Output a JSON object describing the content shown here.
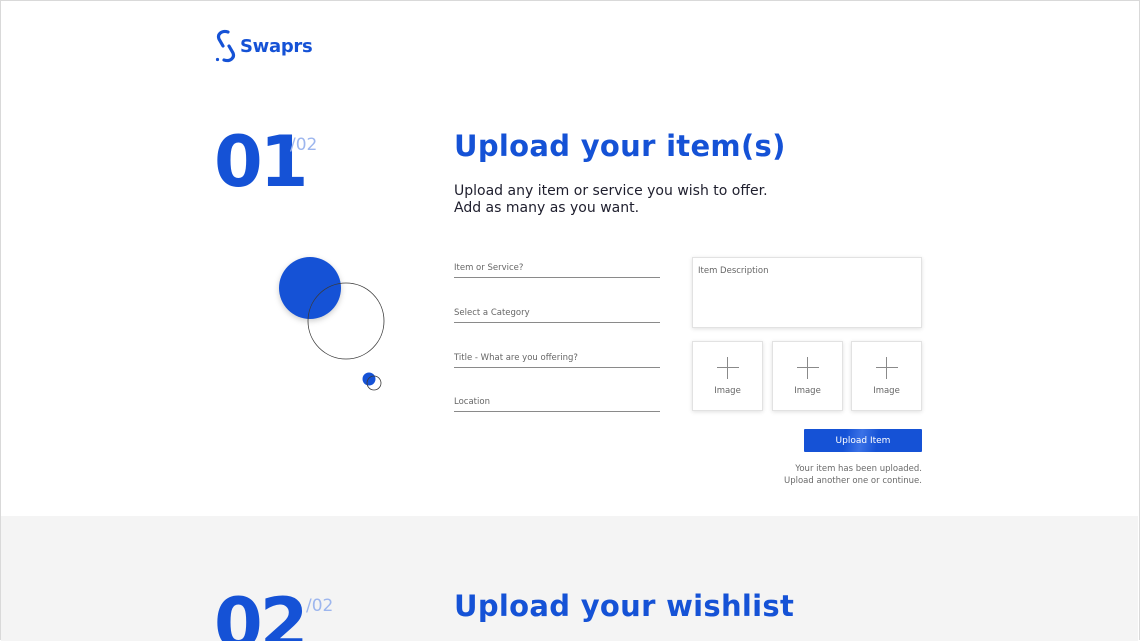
{
  "brand": {
    "name": "Swaprs",
    "logo_icon": "chain-link-s-icon",
    "color": "#1552d6"
  },
  "step1": {
    "number": "01",
    "total": "/02",
    "title": "Upload your item(s)",
    "subtitle_line1": "Upload any item or service you wish to offer.",
    "subtitle_line2": "Add as many as you want."
  },
  "form": {
    "item_placeholder": "Item or Service?",
    "category_placeholder": "Select a Category",
    "title_placeholder": "Title - What are you offering?",
    "location_placeholder": "Location",
    "description_placeholder": "Item Description",
    "image_slots": [
      "Image",
      "Image",
      "Image"
    ],
    "image_slot_icon": "plus-icon",
    "upload_label": "Upload Item",
    "status_line1": "Your item has been uploaded.",
    "status_line2": "Upload another one or continue."
  },
  "step2": {
    "number": "02",
    "total": "/02",
    "title": "Upload your wishlist"
  }
}
